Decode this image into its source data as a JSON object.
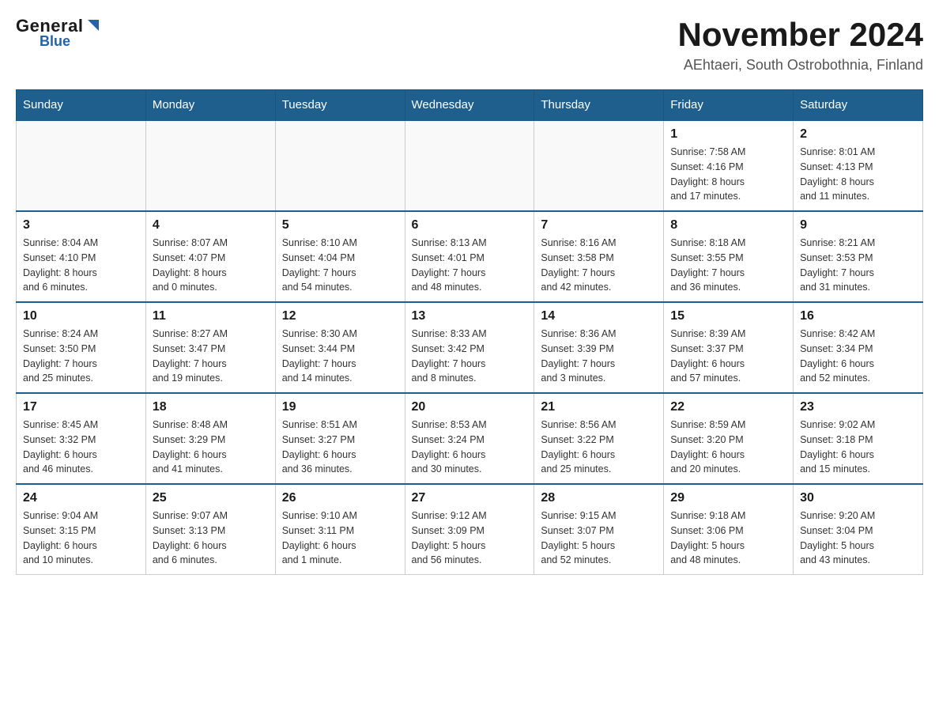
{
  "header": {
    "logo_general": "General",
    "logo_flag": "▶",
    "logo_blue": "Blue",
    "month_title": "November 2024",
    "location": "AEhtaeri, South Ostrobothnia, Finland"
  },
  "weekdays": [
    "Sunday",
    "Monday",
    "Tuesday",
    "Wednesday",
    "Thursday",
    "Friday",
    "Saturday"
  ],
  "weeks": [
    [
      {
        "day": "",
        "info": ""
      },
      {
        "day": "",
        "info": ""
      },
      {
        "day": "",
        "info": ""
      },
      {
        "day": "",
        "info": ""
      },
      {
        "day": "",
        "info": ""
      },
      {
        "day": "1",
        "info": "Sunrise: 7:58 AM\nSunset: 4:16 PM\nDaylight: 8 hours\nand 17 minutes."
      },
      {
        "day": "2",
        "info": "Sunrise: 8:01 AM\nSunset: 4:13 PM\nDaylight: 8 hours\nand 11 minutes."
      }
    ],
    [
      {
        "day": "3",
        "info": "Sunrise: 8:04 AM\nSunset: 4:10 PM\nDaylight: 8 hours\nand 6 minutes."
      },
      {
        "day": "4",
        "info": "Sunrise: 8:07 AM\nSunset: 4:07 PM\nDaylight: 8 hours\nand 0 minutes."
      },
      {
        "day": "5",
        "info": "Sunrise: 8:10 AM\nSunset: 4:04 PM\nDaylight: 7 hours\nand 54 minutes."
      },
      {
        "day": "6",
        "info": "Sunrise: 8:13 AM\nSunset: 4:01 PM\nDaylight: 7 hours\nand 48 minutes."
      },
      {
        "day": "7",
        "info": "Sunrise: 8:16 AM\nSunset: 3:58 PM\nDaylight: 7 hours\nand 42 minutes."
      },
      {
        "day": "8",
        "info": "Sunrise: 8:18 AM\nSunset: 3:55 PM\nDaylight: 7 hours\nand 36 minutes."
      },
      {
        "day": "9",
        "info": "Sunrise: 8:21 AM\nSunset: 3:53 PM\nDaylight: 7 hours\nand 31 minutes."
      }
    ],
    [
      {
        "day": "10",
        "info": "Sunrise: 8:24 AM\nSunset: 3:50 PM\nDaylight: 7 hours\nand 25 minutes."
      },
      {
        "day": "11",
        "info": "Sunrise: 8:27 AM\nSunset: 3:47 PM\nDaylight: 7 hours\nand 19 minutes."
      },
      {
        "day": "12",
        "info": "Sunrise: 8:30 AM\nSunset: 3:44 PM\nDaylight: 7 hours\nand 14 minutes."
      },
      {
        "day": "13",
        "info": "Sunrise: 8:33 AM\nSunset: 3:42 PM\nDaylight: 7 hours\nand 8 minutes."
      },
      {
        "day": "14",
        "info": "Sunrise: 8:36 AM\nSunset: 3:39 PM\nDaylight: 7 hours\nand 3 minutes."
      },
      {
        "day": "15",
        "info": "Sunrise: 8:39 AM\nSunset: 3:37 PM\nDaylight: 6 hours\nand 57 minutes."
      },
      {
        "day": "16",
        "info": "Sunrise: 8:42 AM\nSunset: 3:34 PM\nDaylight: 6 hours\nand 52 minutes."
      }
    ],
    [
      {
        "day": "17",
        "info": "Sunrise: 8:45 AM\nSunset: 3:32 PM\nDaylight: 6 hours\nand 46 minutes."
      },
      {
        "day": "18",
        "info": "Sunrise: 8:48 AM\nSunset: 3:29 PM\nDaylight: 6 hours\nand 41 minutes."
      },
      {
        "day": "19",
        "info": "Sunrise: 8:51 AM\nSunset: 3:27 PM\nDaylight: 6 hours\nand 36 minutes."
      },
      {
        "day": "20",
        "info": "Sunrise: 8:53 AM\nSunset: 3:24 PM\nDaylight: 6 hours\nand 30 minutes."
      },
      {
        "day": "21",
        "info": "Sunrise: 8:56 AM\nSunset: 3:22 PM\nDaylight: 6 hours\nand 25 minutes."
      },
      {
        "day": "22",
        "info": "Sunrise: 8:59 AM\nSunset: 3:20 PM\nDaylight: 6 hours\nand 20 minutes."
      },
      {
        "day": "23",
        "info": "Sunrise: 9:02 AM\nSunset: 3:18 PM\nDaylight: 6 hours\nand 15 minutes."
      }
    ],
    [
      {
        "day": "24",
        "info": "Sunrise: 9:04 AM\nSunset: 3:15 PM\nDaylight: 6 hours\nand 10 minutes."
      },
      {
        "day": "25",
        "info": "Sunrise: 9:07 AM\nSunset: 3:13 PM\nDaylight: 6 hours\nand 6 minutes."
      },
      {
        "day": "26",
        "info": "Sunrise: 9:10 AM\nSunset: 3:11 PM\nDaylight: 6 hours\nand 1 minute."
      },
      {
        "day": "27",
        "info": "Sunrise: 9:12 AM\nSunset: 3:09 PM\nDaylight: 5 hours\nand 56 minutes."
      },
      {
        "day": "28",
        "info": "Sunrise: 9:15 AM\nSunset: 3:07 PM\nDaylight: 5 hours\nand 52 minutes."
      },
      {
        "day": "29",
        "info": "Sunrise: 9:18 AM\nSunset: 3:06 PM\nDaylight: 5 hours\nand 48 minutes."
      },
      {
        "day": "30",
        "info": "Sunrise: 9:20 AM\nSunset: 3:04 PM\nDaylight: 5 hours\nand 43 minutes."
      }
    ]
  ]
}
